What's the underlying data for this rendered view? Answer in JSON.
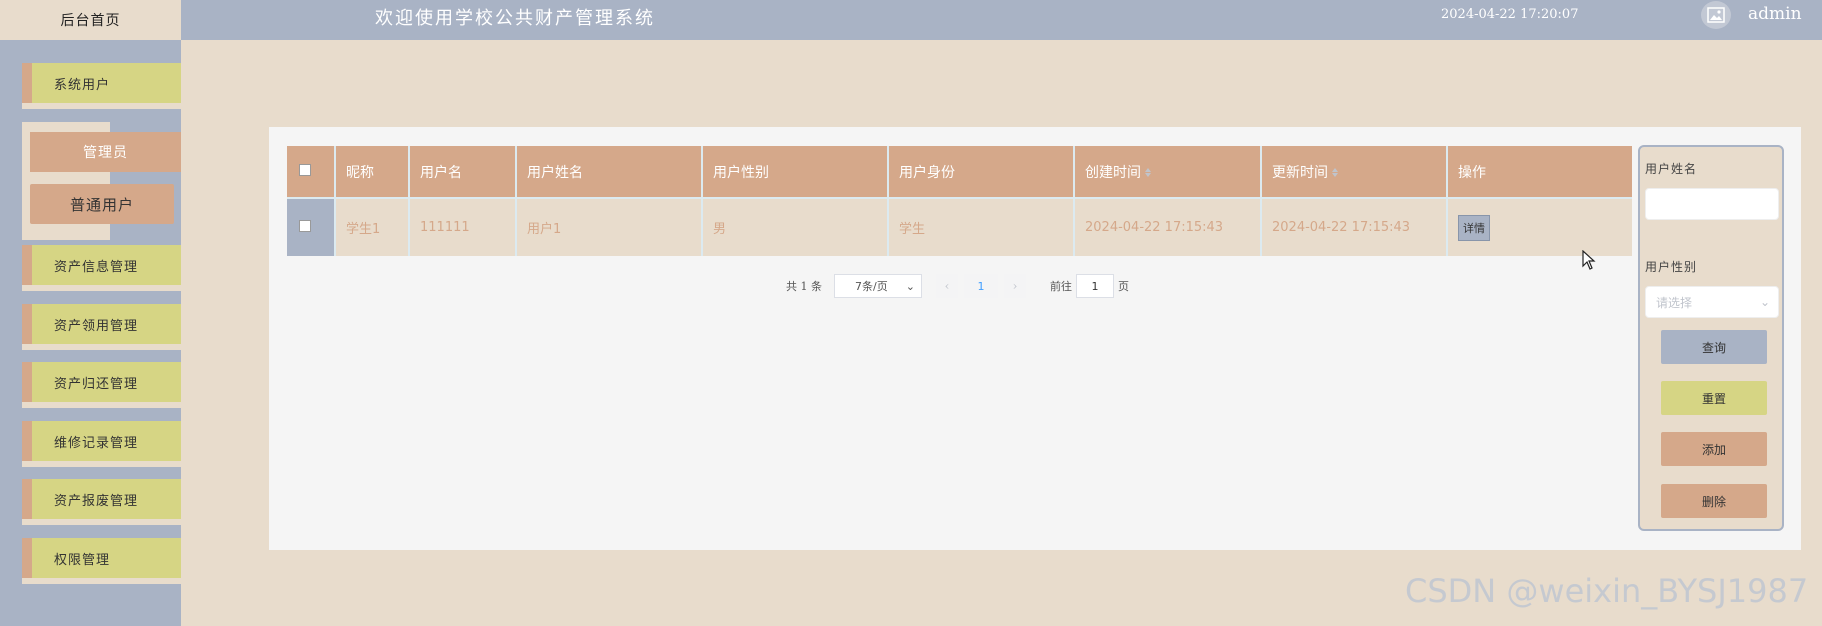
{
  "header": {
    "home_label": "后台首页",
    "title": "欢迎使用学校公共财产管理系统",
    "datetime": "2024-04-22 17:20:07",
    "username": "admin"
  },
  "sidebar": {
    "items": [
      {
        "label": "系统用户"
      },
      {
        "label": "资产信息管理"
      },
      {
        "label": "资产领用管理"
      },
      {
        "label": "资产归还管理"
      },
      {
        "label": "维修记录管理"
      },
      {
        "label": "资产报废管理"
      },
      {
        "label": "权限管理"
      }
    ],
    "sub_items": [
      {
        "label": "管理员"
      },
      {
        "label": "普通用户"
      }
    ]
  },
  "table": {
    "headers": [
      "昵称",
      "用户名",
      "用户姓名",
      "用户性别",
      "用户身份",
      "创建时间",
      "更新时间",
      "操作"
    ],
    "rows": [
      {
        "nickname": "学生1",
        "username": "111111",
        "name": "用户1",
        "gender": "男",
        "identity": "学生",
        "created": "2024-04-22 17:15:43",
        "updated": "2024-04-22 17:15:43",
        "action": "详情"
      }
    ]
  },
  "pagination": {
    "total": "共 1 条",
    "page_size": "7条/页",
    "current_page": "1",
    "goto_label": "前往",
    "goto_value": "1",
    "page_suffix": "页"
  },
  "search": {
    "name_label": "用户姓名",
    "gender_label": "用户性别",
    "gender_placeholder": "请选择",
    "query": "查询",
    "reset": "重置",
    "add": "添加",
    "delete": "删除"
  },
  "watermark": "CSDN @weixin_BYSJ1987",
  "colors": {
    "primary_blue": "#a9b3c5",
    "beige": "#e8dccc",
    "tan": "#d5a88a",
    "olive": "#d6d584"
  }
}
